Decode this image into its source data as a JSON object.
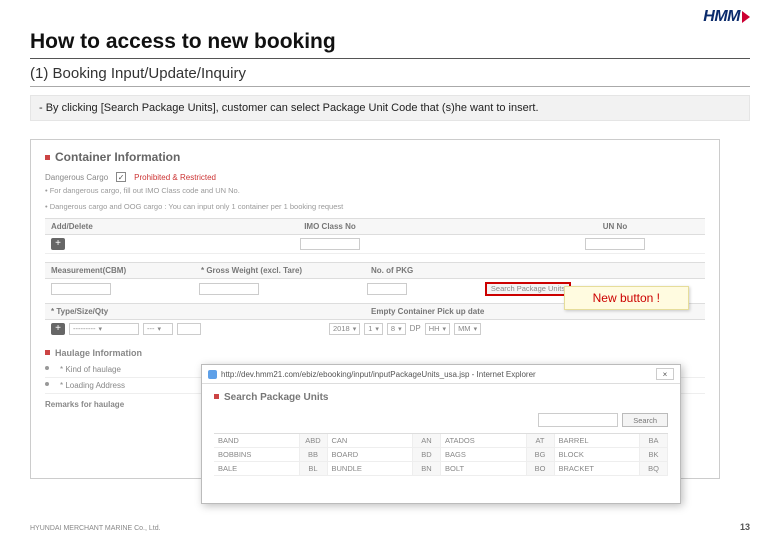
{
  "logo": {
    "text": "HMM"
  },
  "title": "How to access to new booking",
  "subtitle": "(1) Booking Input/Update/Inquiry",
  "note": "- By clicking [Search Package Units], customer can select Package Unit Code that (s)he want to insert.",
  "container_info": {
    "heading": "Container Information",
    "dangerous_label": "Dangerous Cargo",
    "checked": "✓",
    "pr_label": "Prohibited & Restricted",
    "hint1": "• For dangerous cargo, fill out IMO Class code and UN No.",
    "hint2": "• Dangerous cargo and OOG cargo :  You can input only 1 container per 1 booking request",
    "headers1": {
      "ad": "Add/Delete",
      "imo": "IMO Class No",
      "un": "UN No"
    },
    "row2": {
      "measurement": "Measurement(CBM)",
      "gross": "* Gross Weight (excl. Tare)",
      "pkg": "No. of PKG",
      "btn": "Search Package Units"
    },
    "row3": {
      "type": "* Type/Size/Qty",
      "pickup": "Empty Container Pick up date"
    },
    "dates": {
      "y": "2018",
      "m": "1",
      "d": "8",
      "dp": "DP",
      "hh": "HH",
      "mm": "MM"
    },
    "type_sel": "---------",
    "size_sel": "---"
  },
  "callout": "New button !",
  "haulage": {
    "heading": "Haulage Information",
    "kind": "* Kind of haulage",
    "loading": "* Loading Address",
    "remarks": "Remarks for haulage"
  },
  "popup": {
    "url": "http://dev.hmm21.com/ebiz/ebooking/input/inputPackageUnits_usa.jsp - Internet Explorer",
    "heading": "Search Package Units",
    "search_btn": "Search",
    "rows": [
      [
        "BAND",
        "ABD",
        "CAN",
        "AN",
        "ATADOS",
        "AT",
        "BARREL",
        "BA"
      ],
      [
        "BOBBINS",
        "BB",
        "BOARD",
        "BD",
        "BAGS",
        "BG",
        "BLOCK",
        "BK"
      ],
      [
        "BALE",
        "BL",
        "BUNDLE",
        "BN",
        "BOLT",
        "BO",
        "BRACKET",
        "BQ"
      ]
    ]
  },
  "footer": "HYUNDAI MERCHANT MARINE Co., Ltd.",
  "page": "13"
}
